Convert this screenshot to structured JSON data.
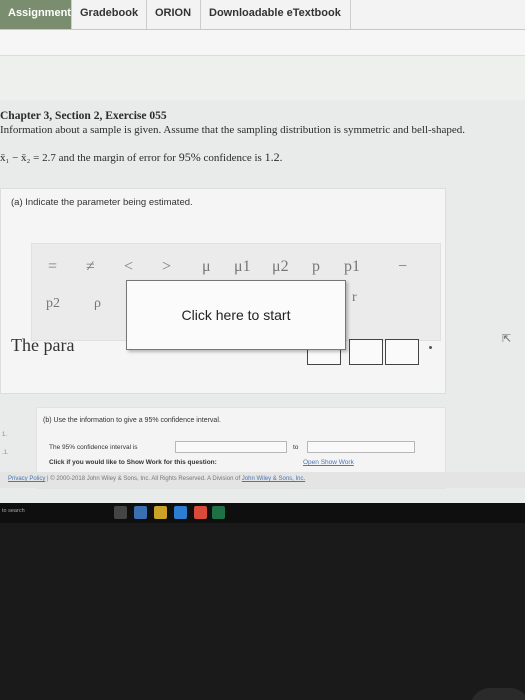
{
  "tabs": [
    "Assignment",
    "Gradebook",
    "ORION",
    "Downloadable eTextbook"
  ],
  "exercise": {
    "title": "Chapter 3, Section 2, Exercise 055",
    "info": "Information about a sample is given. Assume that the sampling distribution is symmetric and bell-shaped.",
    "given_prefix": "x̄₁ − x̄₂ = 2.7",
    "given_mid": " and the margin of error for ",
    "given_conf": "95%",
    "given_mid2": " confidence is ",
    "given_moe": "1.2",
    "given_end": "."
  },
  "part_a": {
    "label": "(a) Indicate the parameter being estimated.",
    "palette": [
      "=",
      "≠",
      "<",
      ">",
      "μ",
      "μ1",
      "μ2",
      "p",
      "p1",
      "−",
      "p2",
      "ρ",
      "r"
    ],
    "math_text": "The para"
  },
  "overlay": {
    "label": "Click here to start"
  },
  "part_b": {
    "label": "(b) Use the information to give a 95% confidence interval.",
    "ci_label": "The 95% confidence interval is",
    "ci_to": "to",
    "show_work_question": "Click if you would like to Show Work for this question:",
    "show_work_link": "Open Show Work"
  },
  "footer": {
    "privacy": "Privacy Policy",
    "separator": "|",
    "copyright": "© 2000-2018 John Wiley & Sons, Inc.",
    "rights": "All Rights Reserved. A Division of",
    "company_link": "John Wiley & Sons, Inc."
  },
  "taskbar": {
    "search_text": "to search"
  },
  "colors": {
    "active_tab": "#7a8d6e",
    "link": "#4b75b4",
    "taskbar": "#0f0f0f"
  }
}
